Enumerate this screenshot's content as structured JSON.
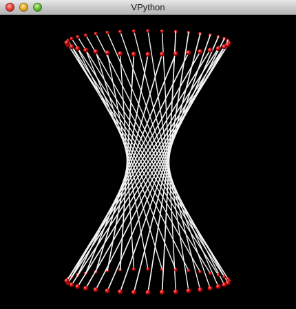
{
  "window": {
    "title": "VPython"
  },
  "titlebar": {
    "buttons": [
      "close",
      "minimize",
      "zoom"
    ],
    "colors": {
      "close": "#e6463c",
      "minimize": "#e9ad2a",
      "zoom": "#6cbf3a"
    }
  },
  "scene": {
    "background": "#000000",
    "string_color": "#f2f2f2",
    "bead_color": "#dd1111",
    "bead_count": 36,
    "twist_degrees": 150
  }
}
